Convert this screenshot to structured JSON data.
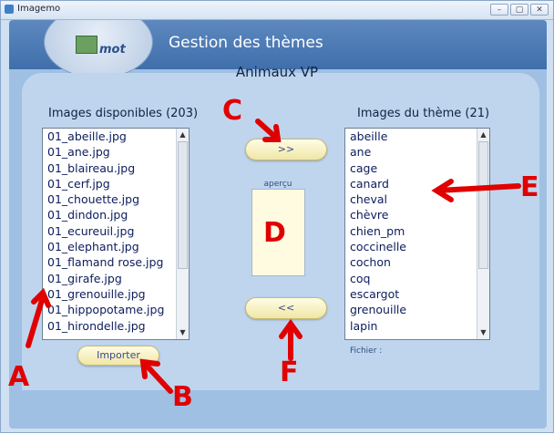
{
  "window": {
    "title": "Imagemo",
    "controls": [
      "–",
      "▢",
      "✕"
    ]
  },
  "header": {
    "logo_text": "mot",
    "title": "Gestion des thèmes"
  },
  "theme": {
    "name": "Animaux VP"
  },
  "available": {
    "label": "Images disponibles (203)",
    "items": [
      "01_abeille.jpg",
      "01_ane.jpg",
      "01_blaireau.jpg",
      "01_cerf.jpg",
      "01_chouette.jpg",
      "01_dindon.jpg",
      "01_ecureuil.jpg",
      "01_elephant.jpg",
      "01_flamand rose.jpg",
      "01_girafe.jpg",
      "01_grenouille.jpg",
      "01_hippopotame.jpg",
      "01_hirondelle.jpg"
    ]
  },
  "theme_images": {
    "label": "Images du thème (21)",
    "items": [
      "abeille",
      "ane",
      "cage",
      "canard",
      "cheval",
      "chèvre",
      "chien_pm",
      "coccinelle",
      "cochon",
      "coq",
      "escargot",
      "grenouille",
      "lapin"
    ]
  },
  "buttons": {
    "add": ">>",
    "remove": "<<",
    "import": "Importer"
  },
  "preview": {
    "label": "aperçu"
  },
  "file_label": "Fichier :",
  "annotations": {
    "A": "A",
    "B": "B",
    "C": "C",
    "D": "D",
    "E": "E",
    "F": "F"
  },
  "colors": {
    "annotation": "#e00000",
    "header": "#4a78b5",
    "button": "#f6efbe"
  }
}
